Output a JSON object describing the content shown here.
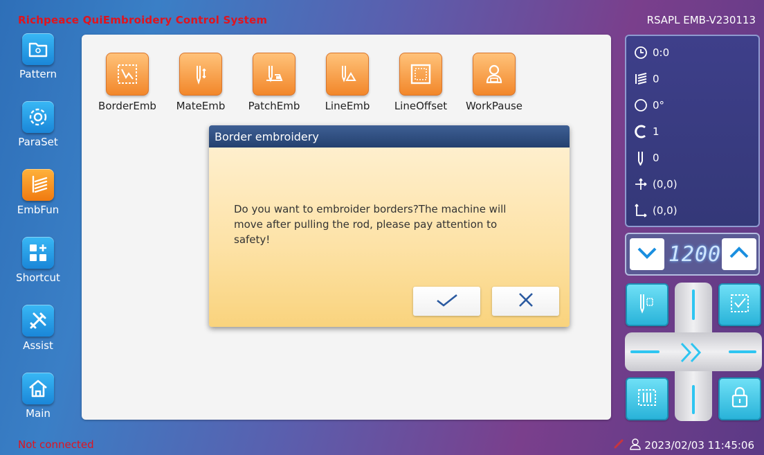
{
  "header": {
    "app_title": "Richpeace QuiEmbroidery Control System",
    "version": "RSAPL EMB-V230113"
  },
  "sidebar": {
    "items": [
      {
        "label": "Pattern",
        "icon": "folder-icon"
      },
      {
        "label": "ParaSet",
        "icon": "gear-icon"
      },
      {
        "label": "EmbFun",
        "icon": "embroidery-icon",
        "active": true
      },
      {
        "label": "Shortcut",
        "icon": "shortcut-grid-icon"
      },
      {
        "label": "Assist",
        "icon": "tools-icon"
      },
      {
        "label": "Main",
        "icon": "home-icon"
      }
    ]
  },
  "functions": [
    {
      "label": "BorderEmb",
      "icon": "border-emb-icon"
    },
    {
      "label": "MateEmb",
      "icon": "mate-emb-icon"
    },
    {
      "label": "PatchEmb",
      "icon": "patch-emb-icon"
    },
    {
      "label": "LineEmb",
      "icon": "line-emb-icon"
    },
    {
      "label": "LineOffset",
      "icon": "line-offset-icon"
    },
    {
      "label": "WorkPause",
      "icon": "work-pause-icon"
    }
  ],
  "dialog": {
    "title": "Border embroidery",
    "message": "Do you want to embroider borders?The machine will move after pulling the rod, please pay attention to safety!",
    "confirm_icon": "check-icon",
    "cancel_icon": "close-icon"
  },
  "status": {
    "time": "0:0",
    "stitch_count": "0",
    "angle": "0°",
    "color": "1",
    "needle": "0",
    "position": "(0,0)",
    "origin": "(0,0)"
  },
  "speed": {
    "value": "1200"
  },
  "footer": {
    "connection": "Not connected",
    "datetime": "2023/02/03 11:45:06"
  },
  "colors": {
    "accent_orange": "#f2872a",
    "accent_blue": "#1a86d8",
    "cyan": "#29b3d9",
    "error_red": "#e0141e",
    "dialog_header": "#24416f"
  }
}
